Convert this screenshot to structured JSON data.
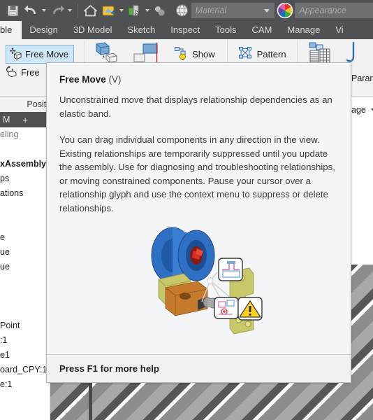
{
  "quick_access": {
    "buttons": [
      {
        "name": "save-icon",
        "glyph": "save"
      },
      {
        "name": "undo-icon",
        "glyph": "undo"
      },
      {
        "name": "undo-dropdown-icon",
        "glyph": "caret"
      },
      {
        "name": "redo-icon",
        "glyph": "redo"
      },
      {
        "name": "redo-dropdown-icon",
        "glyph": "caret"
      },
      {
        "name": "home-icon",
        "glyph": "home"
      },
      {
        "name": "return-icon",
        "glyph": "return"
      },
      {
        "name": "return-dropdown-icon",
        "glyph": "caret"
      },
      {
        "name": "component-color-icon",
        "glyph": "compcolor"
      },
      {
        "name": "component-color-dropdown-icon",
        "glyph": "caret"
      },
      {
        "name": "grounded-icon",
        "glyph": "grounded"
      },
      {
        "name": "appearance-globe-icon",
        "glyph": "globe"
      }
    ],
    "material_field": {
      "placeholder": "Material",
      "value": ""
    },
    "appearance_field": {
      "placeholder": "Appearance",
      "value": ""
    },
    "color_wheel_icon": "color-wheel-icon"
  },
  "ribbon_tabs": [
    {
      "label": "ble",
      "active": true
    },
    {
      "label": "Design",
      "active": false
    },
    {
      "label": "3D Model",
      "active": false
    },
    {
      "label": "Sketch",
      "active": false
    },
    {
      "label": "Inspect",
      "active": false
    },
    {
      "label": "Tools",
      "active": false
    },
    {
      "label": "CAM",
      "active": false
    },
    {
      "label": "Manage",
      "active": false
    },
    {
      "label": "Vi",
      "active": false
    }
  ],
  "ribbon": {
    "free_move_button": {
      "label": "Free Move",
      "icon": "free-move-icon",
      "selected": true
    },
    "free_rotate_button": {
      "label": "Free",
      "icon": "free-rotate-icon"
    },
    "create_button": {
      "icon": "create-component-icon"
    },
    "place_button": {
      "icon": "place-component-icon"
    },
    "show_button": {
      "label": "Show",
      "icon": "show-relationships-icon"
    },
    "pattern_button": {
      "label": "Pattern",
      "icon": "pattern-icon"
    },
    "copy_button": {
      "icon": "copy-component-icon"
    },
    "parameters_label": "Param",
    "manage_label": "age",
    "joint_icon": "joint-icon"
  },
  "left_panel": {
    "position_header": "Positi",
    "tab_label": "M",
    "tab_plus": "+",
    "tree_nodes": [
      {
        "label": "eling",
        "muted": true,
        "bold": false
      },
      {
        "label": "",
        "muted": false,
        "bold": false
      },
      {
        "label": "xAssembly.",
        "muted": false,
        "bold": true
      },
      {
        "label": "ps",
        "muted": false,
        "bold": false
      },
      {
        "label": "ations",
        "muted": false,
        "bold": false
      },
      {
        "label": "",
        "muted": false,
        "bold": false
      },
      {
        "label": "",
        "muted": false,
        "bold": false
      },
      {
        "label": "e",
        "muted": false,
        "bold": false
      },
      {
        "label": "ue",
        "muted": false,
        "bold": false
      },
      {
        "label": "ue",
        "muted": false,
        "bold": false
      },
      {
        "label": "",
        "muted": false,
        "bold": false
      },
      {
        "label": "",
        "muted": false,
        "bold": false
      },
      {
        "label": "",
        "muted": false,
        "bold": false
      },
      {
        "label": "Point",
        "muted": false,
        "bold": false
      },
      {
        "label": ":1",
        "muted": false,
        "bold": false
      },
      {
        "label": "e1",
        "muted": false,
        "bold": false
      },
      {
        "label": "oard_CPY:1",
        "muted": false,
        "bold": false
      },
      {
        "label": "e:1",
        "muted": false,
        "bold": false
      }
    ]
  },
  "tooltip": {
    "title_name": "Free Move",
    "title_key": "(V)",
    "paragraph_1": "Unconstrained move that displays relationship dependencies as an elastic band.",
    "paragraph_2": "You can drag individual components in any direction in the view. Existing relationships are temporarily suppressed until you update the assembly. Use for diagnosing and troubleshooting relationships, or moving constrained components. Pause your cursor over a relationship glyph and use the context menu to suppress or delete relationships.",
    "footer": "Press F1 for more help",
    "illustration_name": "free-move-illustration"
  },
  "colors": {
    "chrome_dark": "#4f5153",
    "ribbon_bg": "#f2f2f2",
    "tooltip_bg": "#f4f5f7",
    "selection_blue": "#cfe6f7",
    "selection_border": "#7eb4d8",
    "accent_blue": "#2b6fb5",
    "warning_yellow": "#ffd21e"
  }
}
